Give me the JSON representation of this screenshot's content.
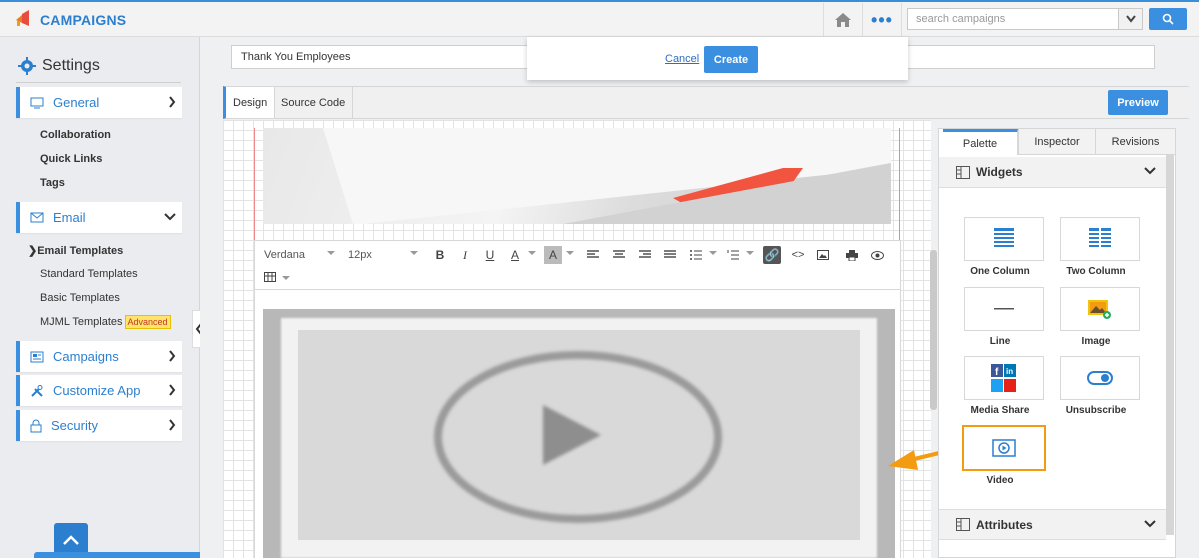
{
  "app": {
    "title": "CAMPAIGNS"
  },
  "search": {
    "placeholder": "search campaigns"
  },
  "sidebar": {
    "heading": "Settings",
    "items": [
      {
        "label": "General"
      },
      {
        "label": "Email"
      },
      {
        "label": "Campaigns"
      },
      {
        "label": "Customize App"
      },
      {
        "label": "Security"
      }
    ],
    "general_sub": [
      "Collaboration",
      "Quick Links",
      "Tags"
    ],
    "email_sub_head": "Email Templates",
    "email_sub": [
      "Standard Templates",
      "Basic Templates",
      "MJML Templates"
    ],
    "badge": "Advanced"
  },
  "form": {
    "name_value": "Thank You Employees",
    "cancel_label": "Cancel",
    "create_label": "Create"
  },
  "tabs": {
    "design": "Design",
    "source": "Source Code",
    "preview": "Preview"
  },
  "editor": {
    "font": "Verdana",
    "size": "12px"
  },
  "panel": {
    "tabs": [
      "Palette",
      "Inspector",
      "Revisions"
    ],
    "widgets_heading": "Widgets",
    "attributes_heading": "Attributes",
    "widgets": [
      "One Column",
      "Two Column",
      "Line",
      "Image",
      "Media Share",
      "Unsubscribe",
      "Video"
    ]
  },
  "colors": {
    "accent": "#3a8fe0",
    "highlight": "#f39c12"
  }
}
